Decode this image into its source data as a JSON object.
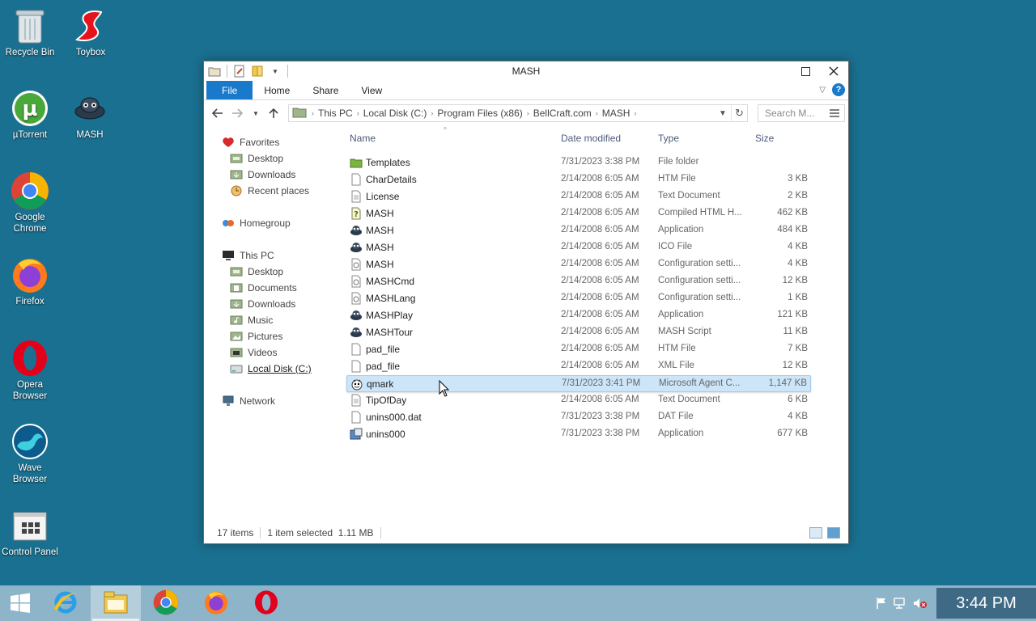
{
  "desktop": {
    "icons": [
      {
        "label": "Recycle Bin",
        "icon": "recycle-bin-icon"
      },
      {
        "label": "Toybox",
        "icon": "toybox-icon"
      },
      {
        "label": "µTorrent",
        "icon": "utorrent-icon"
      },
      {
        "label": "MASH",
        "icon": "mash-icon"
      },
      {
        "label": "Google Chrome",
        "icon": "chrome-icon"
      },
      {
        "label": "Firefox",
        "icon": "firefox-icon"
      },
      {
        "label": "Opera Browser",
        "icon": "opera-icon"
      },
      {
        "label": "Wave Browser",
        "icon": "wave-browser-icon"
      },
      {
        "label": "Control Panel",
        "icon": "control-panel-icon"
      }
    ]
  },
  "window": {
    "title": "MASH",
    "ribbon_tabs": [
      "File",
      "Home",
      "Share",
      "View"
    ],
    "address": {
      "crumbs": [
        "This PC",
        "Local Disk (C:)",
        "Program Files (x86)",
        "BellCraft.com",
        "MASH"
      ]
    },
    "search_placeholder": "Search M...",
    "nav": {
      "favorites": "Favorites",
      "fav_items": [
        "Desktop",
        "Downloads",
        "Recent places"
      ],
      "homegroup": "Homegroup",
      "this_pc": "This PC",
      "pc_items": [
        "Desktop",
        "Documents",
        "Downloads",
        "Music",
        "Pictures",
        "Videos",
        "Local Disk (C:)"
      ],
      "network": "Network"
    },
    "columns": {
      "name": "Name",
      "date": "Date modified",
      "type": "Type",
      "size": "Size"
    },
    "files": [
      {
        "name": "Templates",
        "date": "7/31/2023 3:38 PM",
        "type": "File folder",
        "size": ""
      },
      {
        "name": "CharDetails",
        "date": "2/14/2008 6:05 AM",
        "type": "HTM File",
        "size": "3 KB"
      },
      {
        "name": "License",
        "date": "2/14/2008 6:05 AM",
        "type": "Text Document",
        "size": "2 KB"
      },
      {
        "name": "MASH",
        "date": "2/14/2008 6:05 AM",
        "type": "Compiled HTML H...",
        "size": "462 KB"
      },
      {
        "name": "MASH",
        "date": "2/14/2008 6:05 AM",
        "type": "Application",
        "size": "484 KB"
      },
      {
        "name": "MASH",
        "date": "2/14/2008 6:05 AM",
        "type": "ICO File",
        "size": "4 KB"
      },
      {
        "name": "MASH",
        "date": "2/14/2008 6:05 AM",
        "type": "Configuration setti...",
        "size": "4 KB"
      },
      {
        "name": "MASHCmd",
        "date": "2/14/2008 6:05 AM",
        "type": "Configuration setti...",
        "size": "12 KB"
      },
      {
        "name": "MASHLang",
        "date": "2/14/2008 6:05 AM",
        "type": "Configuration setti...",
        "size": "1 KB"
      },
      {
        "name": "MASHPlay",
        "date": "2/14/2008 6:05 AM",
        "type": "Application",
        "size": "121 KB"
      },
      {
        "name": "MASHTour",
        "date": "2/14/2008 6:05 AM",
        "type": "MASH Script",
        "size": "11 KB"
      },
      {
        "name": "pad_file",
        "date": "2/14/2008 6:05 AM",
        "type": "HTM File",
        "size": "7 KB"
      },
      {
        "name": "pad_file",
        "date": "2/14/2008 6:05 AM",
        "type": "XML File",
        "size": "12 KB"
      },
      {
        "name": "qmark",
        "date": "7/31/2023 3:41 PM",
        "type": "Microsoft Agent C...",
        "size": "1,147 KB"
      },
      {
        "name": "TipOfDay",
        "date": "2/14/2008 6:05 AM",
        "type": "Text Document",
        "size": "6 KB"
      },
      {
        "name": "unins000.dat",
        "date": "7/31/2023 3:38 PM",
        "type": "DAT File",
        "size": "4 KB"
      },
      {
        "name": "unins000",
        "date": "7/31/2023 3:38 PM",
        "type": "Application",
        "size": "677 KB"
      }
    ],
    "status": {
      "count": "17 items",
      "selection": "1 item selected  1.11 MB"
    }
  },
  "taskbar": {
    "clock": "3:44 PM"
  },
  "colors": {
    "desktop": "#1a7090",
    "accent": "#1979ca",
    "selection": "#cce5f8",
    "taskbar": "#8db4c9"
  }
}
